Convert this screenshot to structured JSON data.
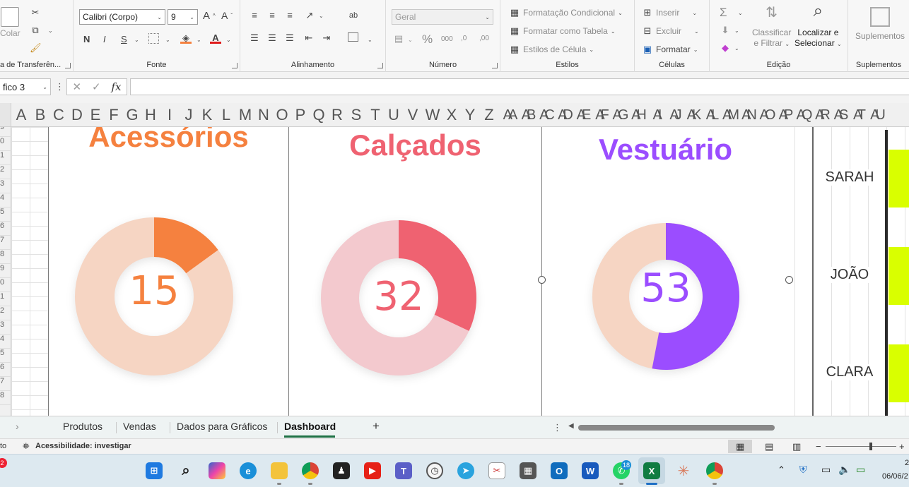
{
  "ribbon": {
    "clipboard": {
      "paste_label": "Colar",
      "group_label": "a de Transferên..."
    },
    "font": {
      "font_name": "Calibri (Corpo)",
      "font_size": "9",
      "bold": "N",
      "italic": "I",
      "strike": "S",
      "increase": "A^",
      "decrease": "A˅",
      "group_label": "Fonte"
    },
    "alignment": {
      "group_label": "Alinhamento",
      "wrap": "ab"
    },
    "number": {
      "format": "Geral",
      "percent": "%",
      "thousands": "000",
      "inc_dec": ",0",
      "dec_dec": ",00",
      "group_label": "Número"
    },
    "styles": {
      "conditional": "Formatação Condicional",
      "table": "Formatar como Tabela",
      "cell_styles": "Estilos de Célula",
      "group_label": "Estilos"
    },
    "cells": {
      "insert": "Inserir",
      "delete": "Excluir",
      "format": "Formatar",
      "group_label": "Células"
    },
    "editing": {
      "sum": "Σ",
      "sort_filter_1": "Classificar",
      "sort_filter_2": "e Filtrar",
      "find_1": "Localizar e",
      "find_2": "Selecionar",
      "group_label": "Edição"
    },
    "addins": {
      "label": "Suplementos",
      "group_label": "Suplementos"
    }
  },
  "formula_bar": {
    "name_box": "fico 3",
    "fx": "fx",
    "cancel": "✕",
    "enter": "✓",
    "more": "⋮"
  },
  "columns": [
    "A",
    "B",
    "C",
    "D",
    "E",
    "F",
    "G",
    "H",
    "I",
    "J",
    "K",
    "L",
    "M",
    "N",
    "O",
    "P",
    "Q",
    "R",
    "S",
    "T",
    "U",
    "V",
    "W",
    "X",
    "Y",
    "Z",
    "AA",
    "AB",
    "AC",
    "AD",
    "AE",
    "AF",
    "AG",
    "AH",
    "AI",
    "AJ",
    "AK",
    "AL",
    "AM",
    "AN",
    "AO",
    "AP",
    "AQ",
    "AR",
    "AS",
    "AT",
    "AU"
  ],
  "row_numbers": [
    "9",
    "0",
    "1",
    "2",
    "3",
    "4",
    "5",
    "6",
    "7",
    "8",
    "9",
    "0",
    "1",
    "2",
    "3",
    "4",
    "5",
    "6",
    "7",
    "8"
  ],
  "charts": [
    {
      "title": "Acessórios",
      "value": 15,
      "display": "15",
      "title_color": "#f5813f",
      "value_color": "#f5813f",
      "ring_color": "#f6d5c3"
    },
    {
      "title": "Calçados",
      "value": 32,
      "display": "32",
      "title_color": "#ef6271",
      "value_color": "#ef6271",
      "ring_color": "#f3c9ce"
    },
    {
      "title": "Vestuário",
      "value": 53,
      "display": "53",
      "title_color": "#9b4dff",
      "value_color": "#9b4dff",
      "ring_color": "#f6d5c3"
    }
  ],
  "names": [
    "SARAH",
    "JOÃO",
    "CLARA"
  ],
  "tabs": {
    "items": [
      "Produtos",
      "Vendas",
      "Dados para Gráficos",
      "Dashboard"
    ],
    "active": "Dashboard",
    "add": "+"
  },
  "status": {
    "left": "to",
    "accessibility": "Acessibilidade: investigar",
    "zoom_minus": "−",
    "zoom_plus": "+"
  },
  "taskbar": {
    "badge_left": "2",
    "whatsapp_badge": "18",
    "time": "2",
    "date": "06/06/2"
  }
}
